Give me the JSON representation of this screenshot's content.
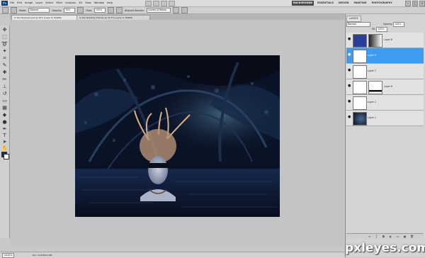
{
  "app": {
    "logo": "Ps"
  },
  "menu": [
    "File",
    "Edit",
    "Image",
    "Layer",
    "Select",
    "Filter",
    "Analysis",
    "3D",
    "View",
    "Window",
    "Help"
  ],
  "workspaces": [
    {
      "label": "BACKGROUND",
      "active": true
    },
    {
      "label": "ESSENTIALS",
      "active": false
    },
    {
      "label": "DESIGN",
      "active": false
    },
    {
      "label": "PAINTING",
      "active": false
    },
    {
      "label": "PHOTOGRAPHY",
      "active": false
    }
  ],
  "window_buttons": [
    "–",
    "□",
    "×"
  ],
  "options_bar": {
    "mode_label": "Mode:",
    "mode_value": "Normal",
    "opacity_label": "Opacity:",
    "opacity_value": "50%",
    "flow_label": "Flow:",
    "flow_value": "100%",
    "sample_label": "Aligned Sample:",
    "sample_value": "Current & Below"
  },
  "tabs": [
    {
      "label": "In the Shadows.psd @ 25% (Layer 8, RGB/8)",
      "active": true
    },
    {
      "label": "In the Shadows Fullsize @ 16.7% (Layer 5, RGB/8)",
      "active": false
    }
  ],
  "status": {
    "zoom": "16.67%",
    "doc": "Doc: 6.00M/22.6M"
  },
  "layers_panel": {
    "tab_label": "LAYERS",
    "blend_mode": "Normal",
    "opacity_label": "Opacity:",
    "opacity_value": "100%",
    "fill_label": "Fill:",
    "fill_value": "100%",
    "layers": [
      {
        "name": "Layer 8",
        "selected": false,
        "thumb": "blue-fill",
        "mask": "gradient"
      },
      {
        "name": "Layer 9",
        "selected": true,
        "thumb": "transparent",
        "mask": "none"
      },
      {
        "name": "Layer 7",
        "selected": false,
        "thumb": "transparent",
        "mask": "none"
      },
      {
        "name": "Layer 6",
        "selected": false,
        "thumb": "transparent",
        "mask": "white-black"
      },
      {
        "name": "Layer 2",
        "selected": false,
        "thumb": "transparent",
        "mask": "none"
      },
      {
        "name": "Layer 1",
        "selected": false,
        "thumb": "image",
        "mask": "none"
      }
    ]
  },
  "colors": {
    "foreground": "#1b2b66",
    "background": "#ffffff",
    "selection": "#3d9cf0",
    "artwork_dark": "#0a1326"
  },
  "watermark": "pxleyes.com"
}
